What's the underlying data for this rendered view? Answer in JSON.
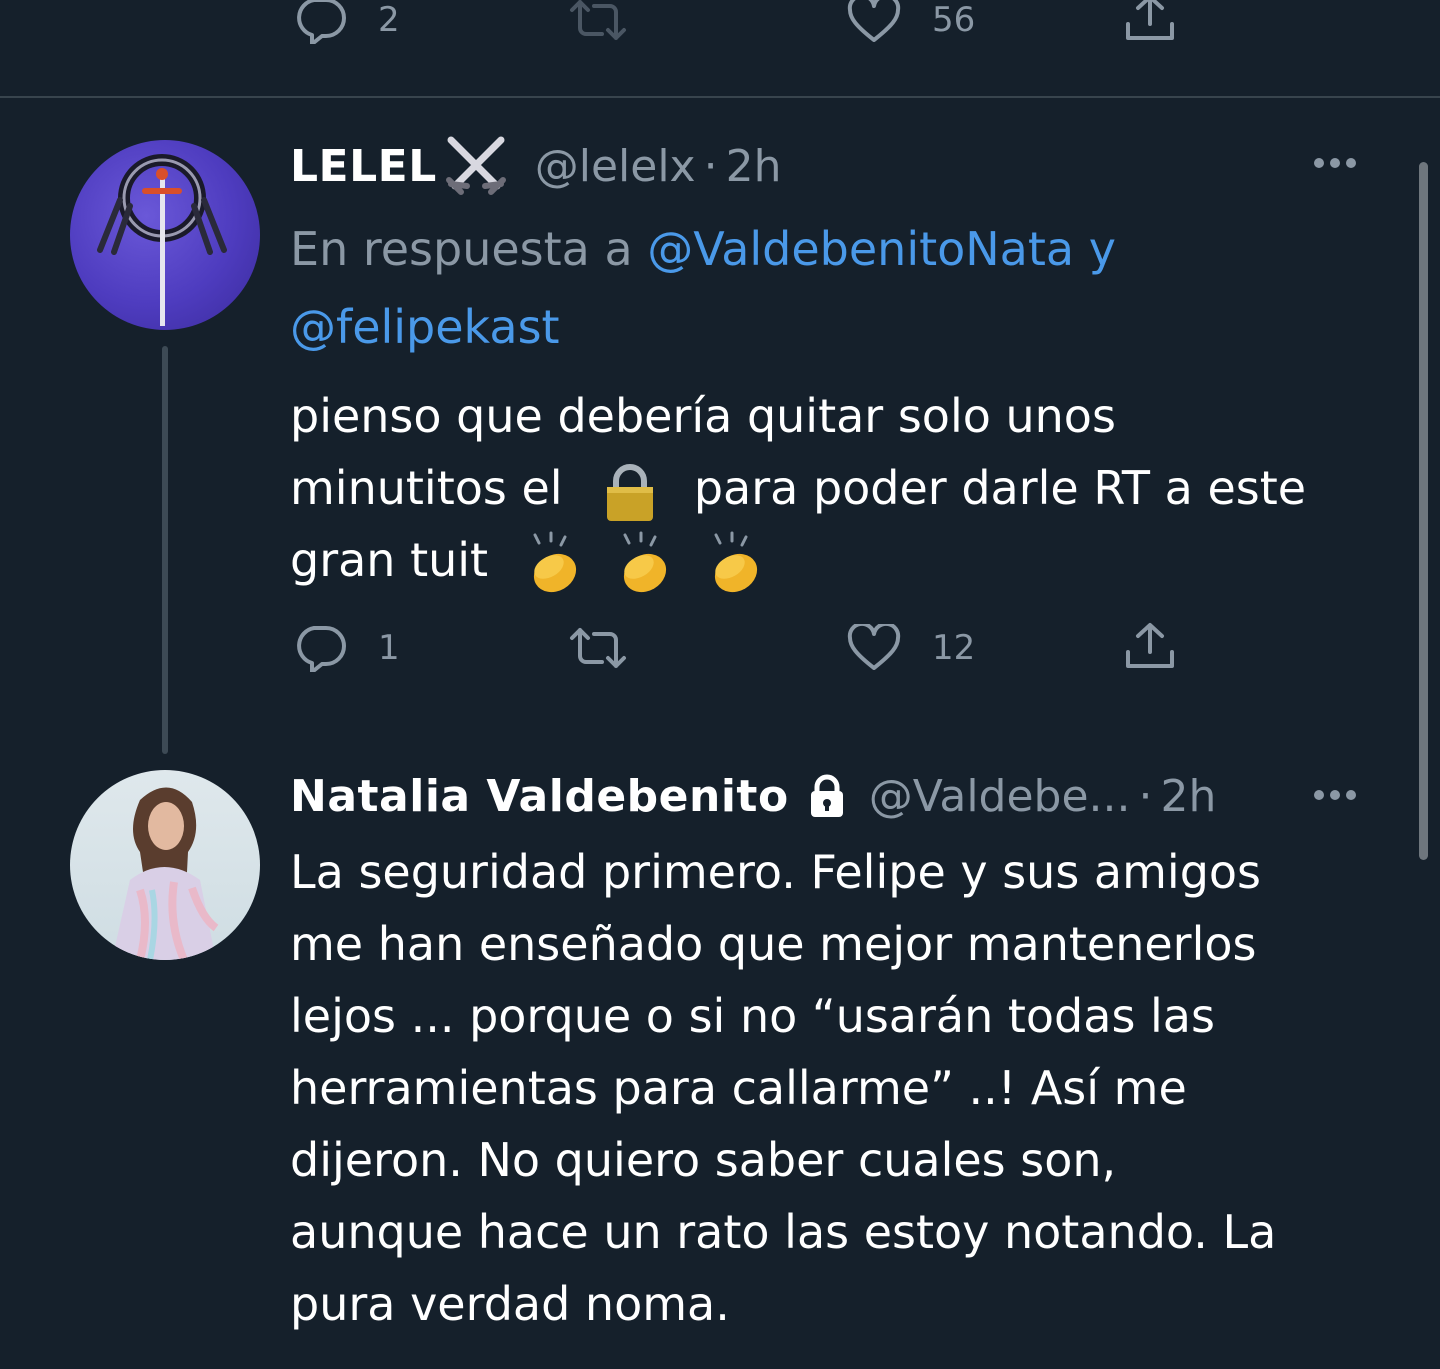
{
  "previous_tweet": {
    "actions": {
      "reply_count": "2",
      "retweet_count": "",
      "like_count": "56"
    }
  },
  "reply_tweet": {
    "display_name": "LELEL",
    "handle": "@lelelx",
    "separator": "·",
    "time": "2h",
    "reply_prefix": "En respuesta a",
    "reply_mention_1": "@ValdebenitoNata",
    "reply_conjunction": "y",
    "reply_mention_2": "@felipekast",
    "text_line_1": "pienso que debería quitar solo unos",
    "text_line_2a": "minutitos el",
    "text_line_2b": "para poder darle RT a este",
    "text_line_3": "gran tuit",
    "emojis": [
      "lock-emoji",
      "clapping-hands-emoji",
      "clapping-hands-emoji",
      "clapping-hands-emoji"
    ],
    "actions": {
      "reply_count": "1",
      "retweet_count": "",
      "like_count": "12"
    }
  },
  "original_tweet": {
    "display_name": "Natalia Valdebenito",
    "protected_icon": "lock-icon",
    "handle": "@Valdebe...",
    "separator": "·",
    "time": "2h",
    "text_lines": [
      "La seguridad primero. Felipe y sus amigos",
      "me han enseñado que mejor mantenerlos",
      "lejos ... porque o si no “usarán todas las",
      "herramientas para callarme” ..! Así me",
      "dijeron. No quiero saber cuales son,",
      "aunque hace un rato las estoy notando. La",
      "pura verdad noma."
    ]
  },
  "colors": {
    "background": "#15202b",
    "text_primary": "#ffffff",
    "text_secondary": "#8b98a5",
    "link": "#4a99e9",
    "divider": "#38444d"
  }
}
